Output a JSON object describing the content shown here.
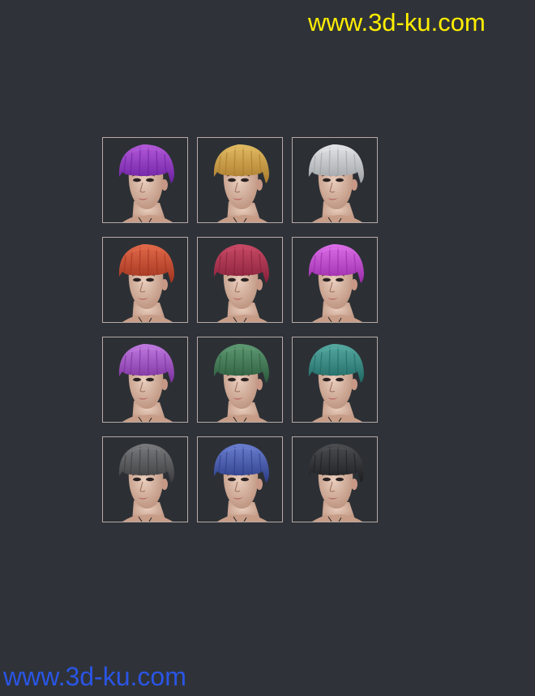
{
  "watermark": {
    "top_text": "www.3d-ku.com",
    "bottom_text": "www.3d-ku.com"
  },
  "tiles": [
    {
      "name": "hair-swatch-purple",
      "hair": "#6a1fa0",
      "hair_hi": "#b35ad9",
      "view": "left"
    },
    {
      "name": "hair-swatch-blonde",
      "hair": "#a97a2c",
      "hair_hi": "#e2bb63",
      "view": "left"
    },
    {
      "name": "hair-swatch-silver",
      "hair": "#9ea1a4",
      "hair_hi": "#e3e5e7",
      "view": "left"
    },
    {
      "name": "hair-swatch-copper",
      "hair": "#a0321e",
      "hair_hi": "#e26a4a",
      "view": "left"
    },
    {
      "name": "hair-swatch-crimson",
      "hair": "#86203a",
      "hair_hi": "#c94a66",
      "view": "left"
    },
    {
      "name": "hair-swatch-magenta",
      "hair": "#9a2aa8",
      "hair_hi": "#dc6fe8",
      "view": "left"
    },
    {
      "name": "hair-swatch-violet",
      "hair": "#7a2f9c",
      "hair_hi": "#c07be0",
      "view": "left"
    },
    {
      "name": "hair-swatch-green",
      "hair": "#2b5a3c",
      "hair_hi": "#5f9a73",
      "view": "left"
    },
    {
      "name": "hair-swatch-teal",
      "hair": "#1f6762",
      "hair_hi": "#56aaa2",
      "view": "left"
    },
    {
      "name": "hair-swatch-grey",
      "hair": "#3c3c3e",
      "hair_hi": "#7a7b7e",
      "view": "left"
    },
    {
      "name": "hair-swatch-blue",
      "hair": "#2c3c86",
      "hair_hi": "#6b7fd0",
      "view": "left"
    },
    {
      "name": "hair-swatch-black",
      "hair": "#1d1e20",
      "hair_hi": "#4c4e52",
      "view": "left"
    }
  ]
}
